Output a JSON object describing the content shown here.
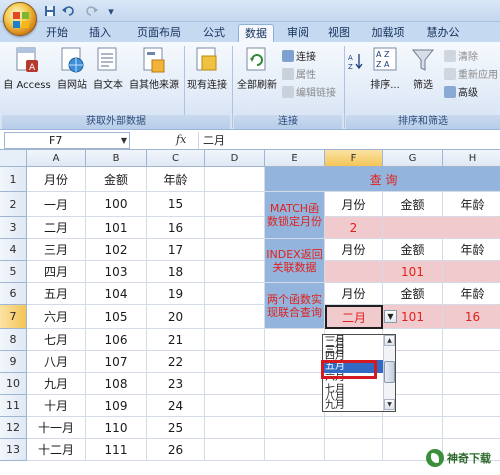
{
  "tabs": [
    "开始",
    "插入",
    "页面布局",
    "公式",
    "数据",
    "审阅",
    "视图",
    "加载项",
    "慧办公"
  ],
  "ribbon": {
    "external": {
      "access": "自 Access",
      "web": "自网站",
      "text": "自文本",
      "other": "自其他来源",
      "existing": "现有连接",
      "group": "获取外部数据"
    },
    "connections": {
      "refresh": "全部刷新",
      "conn": "连接",
      "props": "属性",
      "edit": "编辑链接",
      "group": "连接"
    },
    "sort": {
      "sort": "排序...",
      "filter": "筛选",
      "clear": "清除",
      "reapply": "重新应用",
      "advanced": "高级",
      "group": "排序和筛选"
    }
  },
  "formula": {
    "namebox": "F7",
    "fx": "fx",
    "content": "二月"
  },
  "columns": [
    "A",
    "B",
    "C",
    "D",
    "E",
    "F",
    "G",
    "H"
  ],
  "rows": [
    "1",
    "2",
    "3",
    "4",
    "5",
    "6",
    "7",
    "8",
    "9",
    "10",
    "11",
    "12",
    "13"
  ],
  "table": {
    "headers": [
      "月份",
      "金额",
      "年龄"
    ],
    "months": [
      "一月",
      "二月",
      "三月",
      "四月",
      "五月",
      "六月",
      "七月",
      "八月",
      "九月",
      "十月",
      "十一月",
      "十二月"
    ],
    "amounts": [
      "100",
      "101",
      "102",
      "103",
      "104",
      "105",
      "106",
      "107",
      "108",
      "109",
      "110",
      "111"
    ],
    "ages": [
      "15",
      "16",
      "17",
      "18",
      "19",
      "20",
      "21",
      "22",
      "23",
      "24",
      "25",
      "26"
    ]
  },
  "lookup": {
    "title": "查 询",
    "match_label": "MATCH函数锁定月份",
    "index_label": "INDEX返回关联数据",
    "combo_label": "两个函数实现联合查询",
    "month_h": "月份",
    "amount_h": "金额",
    "age_h": "年龄",
    "match_result": "2",
    "index_result": "101",
    "combo_month": "二月",
    "combo_amount": "101",
    "combo_age": "16"
  },
  "dropdown": {
    "items": [
      "一月",
      "二月",
      "三月",
      "四月",
      "五月",
      "六月",
      "七月",
      "八月",
      "九月"
    ],
    "selected": "五月"
  },
  "watermark": "神奇下载",
  "colors": {
    "lookup_blue": "#93b4dc",
    "lookup_pink": "#f0cacd",
    "accent_red": "#e0211c",
    "highlight": "#316ac5"
  }
}
